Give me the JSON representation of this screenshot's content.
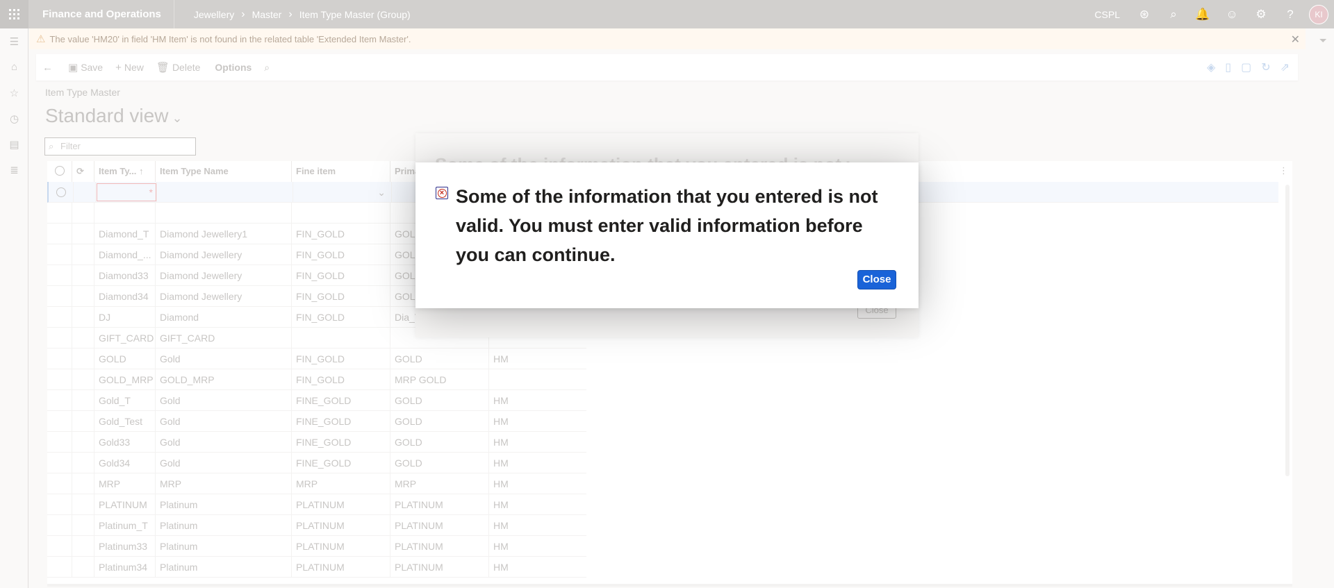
{
  "app": {
    "title": "Finance and Operations",
    "breadcrumb": [
      "Jewellery",
      "Master",
      "Item Type Master (Group)"
    ],
    "company": "CSPL",
    "user_initials": "KI"
  },
  "warning": {
    "message": "The value 'HM20' in field 'HM Item' is not found in the related table 'Extended Item Master'."
  },
  "actions": {
    "save": "Save",
    "new": "New",
    "delete": "Delete",
    "options": "Options"
  },
  "page": {
    "caption": "Item Type Master",
    "view_name": "Standard view",
    "filter_placeholder": "Filter"
  },
  "grid": {
    "columns": [
      "Item Ty...",
      "Item Type Name",
      "Fine item",
      "Prima",
      ""
    ],
    "rows": [
      [
        "",
        "",
        "",
        "",
        ""
      ],
      [
        "Diamond_T",
        "Diamond Jewellery1",
        "FIN_GOLD",
        "GOLD",
        ""
      ],
      [
        "Diamond_...",
        "Diamond Jewellery",
        "FIN_GOLD",
        "GOLD",
        ""
      ],
      [
        "Diamond33",
        "Diamond Jewellery",
        "FIN_GOLD",
        "GOLD",
        ""
      ],
      [
        "Diamond34",
        "Diamond Jewellery",
        "FIN_GOLD",
        "GOLD",
        ""
      ],
      [
        "DJ",
        "Diamond",
        "FIN_GOLD",
        "Dia_T",
        ""
      ],
      [
        "GIFT_CARD",
        "GIFT_CARD",
        "",
        "",
        ""
      ],
      [
        "GOLD",
        "Gold",
        "FIN_GOLD",
        "GOLD",
        "HM"
      ],
      [
        "GOLD_MRP",
        "GOLD_MRP",
        "FIN_GOLD",
        "MRP GOLD",
        ""
      ],
      [
        "Gold_T",
        "Gold",
        "FINE_GOLD",
        "GOLD",
        "HM"
      ],
      [
        "Gold_Test",
        "Gold",
        "FINE_GOLD",
        "GOLD",
        "HM"
      ],
      [
        "Gold33",
        "Gold",
        "FINE_GOLD",
        "GOLD",
        "HM"
      ],
      [
        "Gold34",
        "Gold",
        "FINE_GOLD",
        "GOLD",
        "HM"
      ],
      [
        "MRP",
        "MRP",
        "MRP",
        "MRP",
        "HM"
      ],
      [
        "PLATINUM",
        "Platinum",
        "PLATINUM",
        "PLATINUM",
        "HM"
      ],
      [
        "Platinum_T",
        "Platinum",
        "PLATINUM",
        "PLATINUM",
        "HM"
      ],
      [
        "Platinum33",
        "Platinum",
        "PLATINUM",
        "PLATINUM",
        "HM"
      ],
      [
        "Platinum34",
        "Platinum",
        "PLATINUM",
        "PLATINUM",
        "HM"
      ]
    ]
  },
  "dialog": {
    "message": "Some of the information that you entered is not valid. You must enter valid information before you can continue.",
    "close_label": "Close",
    "ghost_close_label": "Close"
  },
  "colors": {
    "accent": "#1a63d8",
    "error": "#c42b1c",
    "warning_bg": "#fff8f0"
  }
}
